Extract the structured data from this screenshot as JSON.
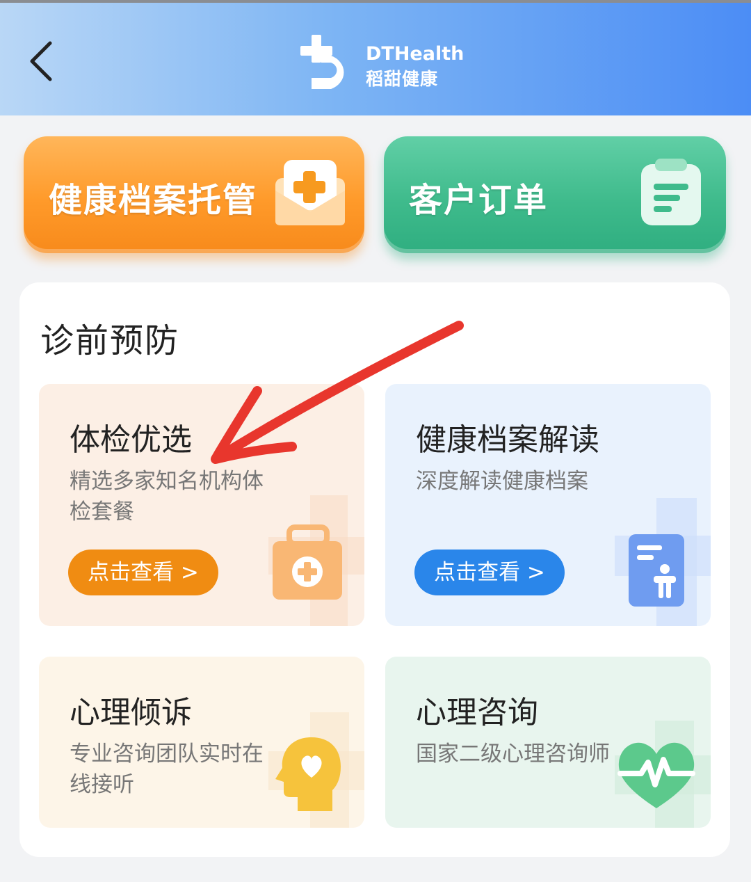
{
  "header": {
    "back_icon": "chevron-left-icon",
    "logo_en": "DTHealth",
    "logo_cn": "稻甜健康",
    "gradient": [
      "#b9d7f6",
      "#4c8df5"
    ]
  },
  "quick_actions": [
    {
      "label": "健康档案托管",
      "icon": "medical-envelope-icon",
      "color": "#ff9a2a"
    },
    {
      "label": "客户订单",
      "icon": "clipboard-icon",
      "color": "#3fbb8c"
    }
  ],
  "section": {
    "title": "诊前预防",
    "tiles": [
      {
        "title": "体检优选",
        "desc": "精选多家知名机构体检套餐",
        "cta": "点击查看 >",
        "icon": "first-aid-kit-icon",
        "bg": "#fcefe5",
        "cta_color": "#f08c12"
      },
      {
        "title": "健康档案解读",
        "desc": "深度解读健康档案",
        "cta": "点击查看 >",
        "icon": "health-record-person-icon",
        "bg": "#e9f2fd",
        "cta_color": "#2a86ea"
      },
      {
        "title": "心理倾诉",
        "desc": "专业咨询团队实时在线接听",
        "icon": "head-heart-icon",
        "bg": "#fdf5e8"
      },
      {
        "title": "心理咨询",
        "desc": "国家二级心理咨询师",
        "icon": "heart-pulse-icon",
        "bg": "#e8f5ee"
      }
    ]
  },
  "annotation": {
    "icon": "red-arrow-icon",
    "color": "#e8362d"
  }
}
